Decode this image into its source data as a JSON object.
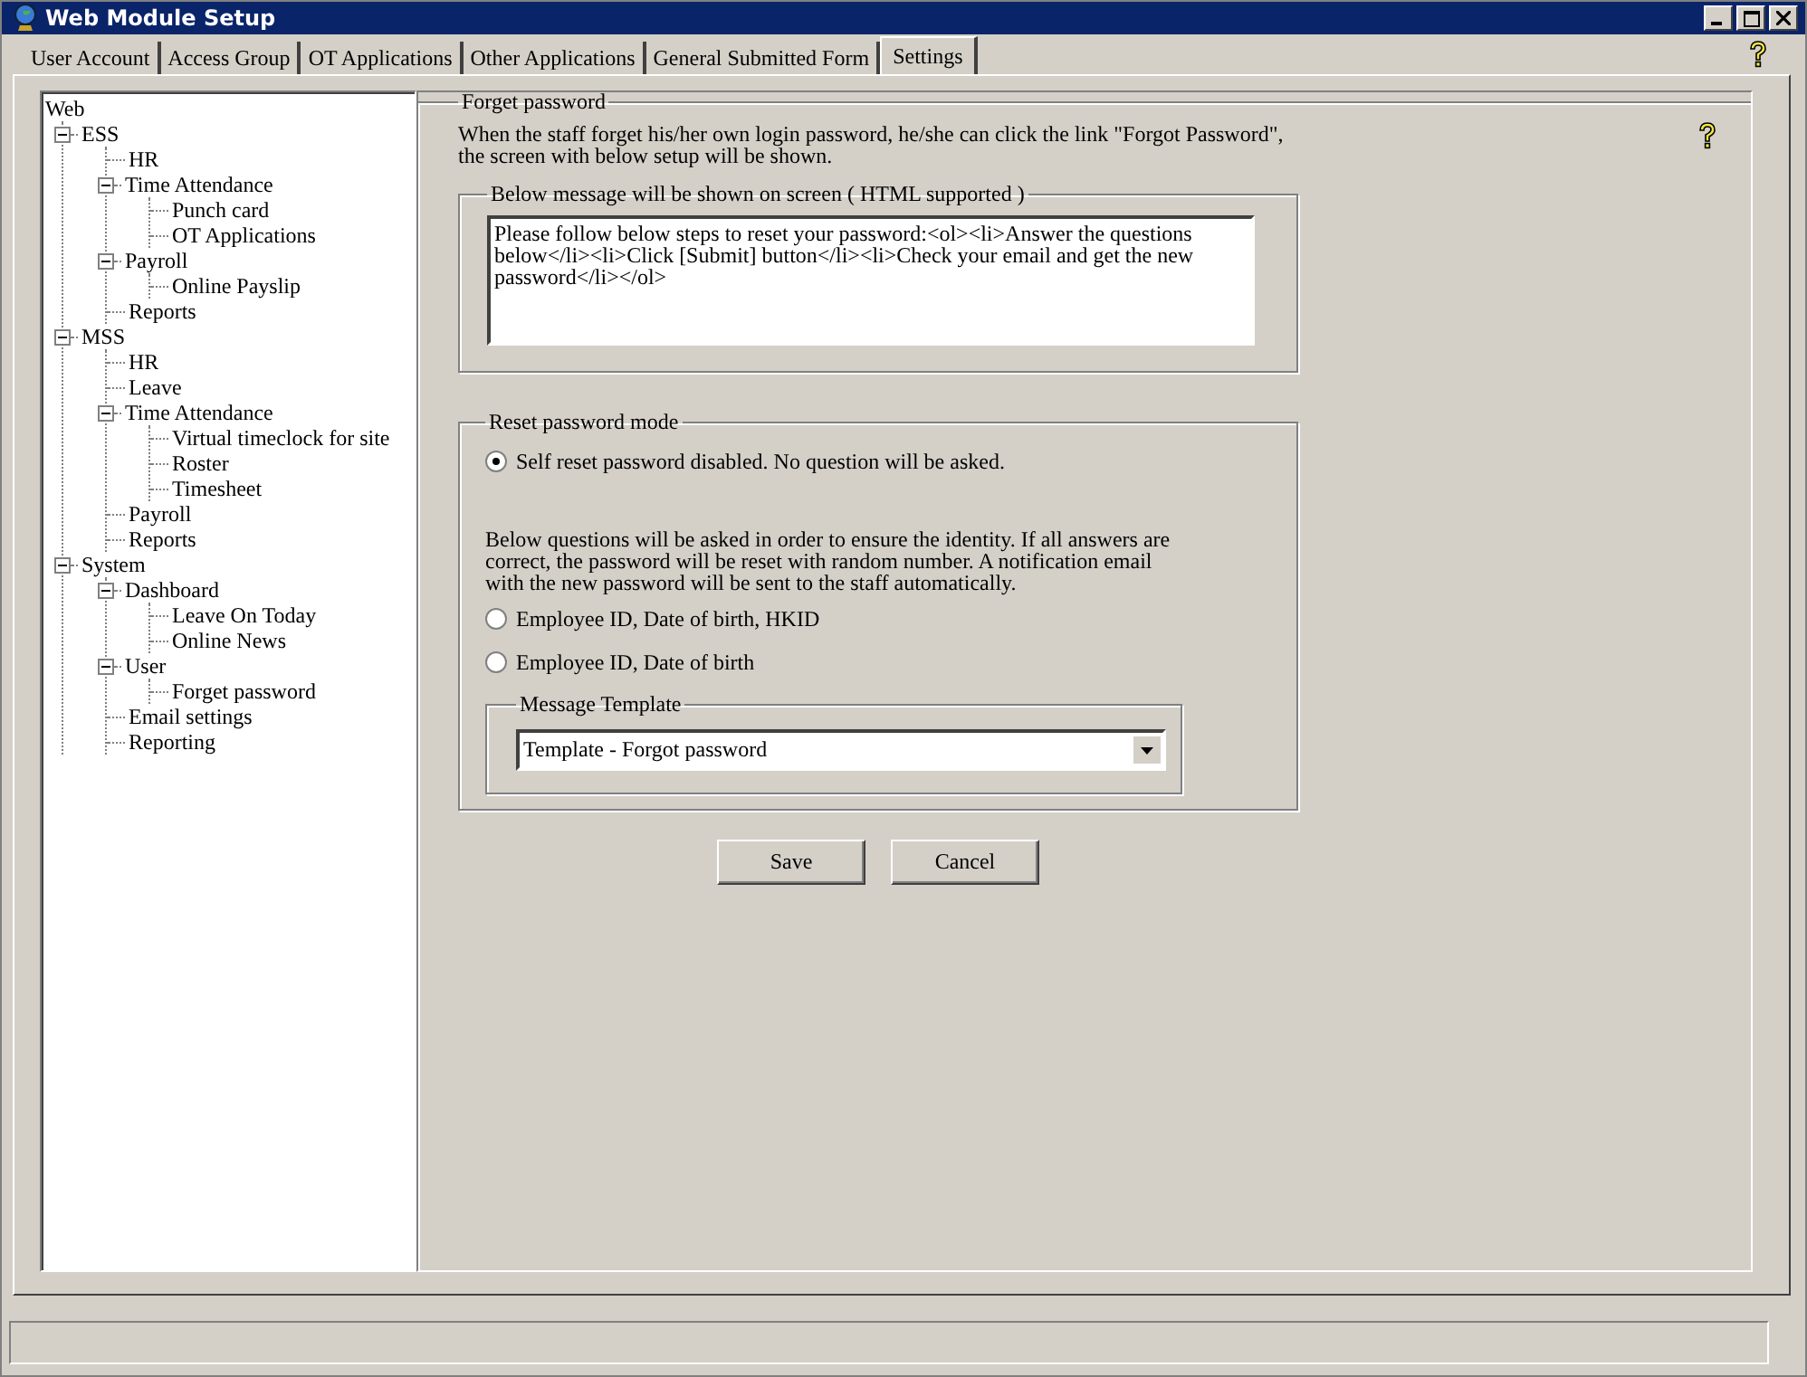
{
  "window": {
    "title": "Web Module Setup"
  },
  "tabs": [
    {
      "label": "User Account",
      "selected": false
    },
    {
      "label": "Access Group",
      "selected": false
    },
    {
      "label": "OT Applications",
      "selected": false
    },
    {
      "label": "Other Applications",
      "selected": false
    },
    {
      "label": "General Submitted Form",
      "selected": false
    },
    {
      "label": "Settings",
      "selected": true
    }
  ],
  "tree": {
    "label": "Web",
    "children": [
      {
        "label": "ESS",
        "expanded": true,
        "children": [
          {
            "label": "HR"
          },
          {
            "label": "Time Attendance",
            "expanded": true,
            "children": [
              {
                "label": "Punch card"
              },
              {
                "label": "OT Applications"
              }
            ]
          },
          {
            "label": "Payroll",
            "expanded": true,
            "children": [
              {
                "label": "Online Payslip"
              }
            ]
          },
          {
            "label": "Reports"
          }
        ]
      },
      {
        "label": "MSS",
        "expanded": true,
        "children": [
          {
            "label": "HR"
          },
          {
            "label": "Leave"
          },
          {
            "label": "Time Attendance",
            "expanded": true,
            "children": [
              {
                "label": "Virtual timeclock for site"
              },
              {
                "label": "Roster"
              },
              {
                "label": "Timesheet"
              }
            ]
          },
          {
            "label": "Payroll"
          },
          {
            "label": "Reports"
          }
        ]
      },
      {
        "label": "System",
        "expanded": true,
        "children": [
          {
            "label": "Dashboard",
            "expanded": true,
            "children": [
              {
                "label": "Leave On Today"
              },
              {
                "label": "Online News"
              }
            ]
          },
          {
            "label": "User",
            "expanded": true,
            "children": [
              {
                "label": "Forget password"
              }
            ]
          },
          {
            "label": "Email settings"
          },
          {
            "label": "Reporting"
          }
        ]
      }
    ]
  },
  "panel": {
    "title": "Forget password",
    "description": "When the staff forget his/her own login password, he/she can click the link \"Forgot Password\", the screen with below setup will be shown.",
    "message_group": {
      "title": "Below message will be shown on screen ( HTML supported )",
      "value": "Please follow below steps to reset your password:<ol><li>Answer the questions below</li><li>Click [Submit] button</li><li>Check your email and get the new password</li></ol>"
    },
    "reset_group": {
      "title": "Reset password mode",
      "disabled_option": {
        "label": "Self reset password disabled. No question will be asked.",
        "selected": true
      },
      "note": "Below questions will be asked in order to ensure the identity. If all answers are correct, the password will be reset with random number. A notification email with the new password will be sent to the staff automatically.",
      "options": [
        {
          "label": "Employee ID, Date of birth, HKID",
          "selected": false
        },
        {
          "label": "Employee ID, Date of birth",
          "selected": false
        }
      ],
      "template_group": {
        "title": "Message Template",
        "value": "Template - Forgot password"
      }
    }
  },
  "buttons": [
    {
      "label": "Save"
    },
    {
      "label": "Cancel"
    }
  ]
}
